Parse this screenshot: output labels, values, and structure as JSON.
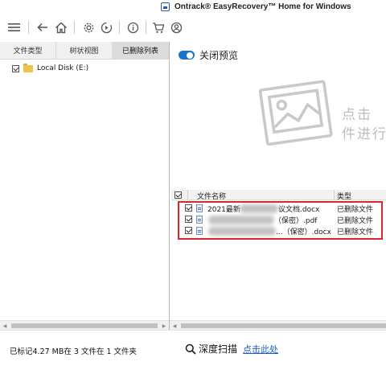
{
  "app": {
    "title": "Ontrack® EasyRecovery™ Home for Windows"
  },
  "toolbar": {
    "icons": [
      "menu-icon",
      "back-icon",
      "home-icon",
      "settings-icon",
      "play-history-icon",
      "info-icon",
      "cart-icon",
      "account-icon"
    ]
  },
  "tabs": [
    {
      "label": "文件类型"
    },
    {
      "label": "树状视图"
    },
    {
      "label": "已删除列表",
      "active": true
    }
  ],
  "tree": {
    "items": [
      {
        "label": "Local Disk (E:)",
        "checked": true
      }
    ]
  },
  "preview": {
    "toggle_label": "关闭预览",
    "enabled": true,
    "hint_line1": "点击",
    "hint_line2": "件进行"
  },
  "table": {
    "columns": [
      "文件名称",
      "类型"
    ],
    "rows": [
      {
        "name_visible": "2021最新",
        "name_suffix": "议文档.docx",
        "type": "已删除文件",
        "checked": true,
        "name_redacted": true
      },
      {
        "name_visible": "",
        "name_suffix": "（保密）.pdf",
        "type": "已删除文件",
        "checked": true,
        "name_redacted": true
      },
      {
        "name_visible": "",
        "name_suffix": "...（保密）.docx",
        "type": "已删除文件",
        "checked": true,
        "name_redacted": true
      }
    ]
  },
  "status": {
    "text": "已标记4.27 MB在 3 文件在 1 文件夹"
  },
  "deep_scan": {
    "label": "深度扫描",
    "link": "点击此处"
  },
  "colors": {
    "accent": "#1a73c8",
    "highlight": "#d9272e",
    "link": "#1b5fc1"
  }
}
